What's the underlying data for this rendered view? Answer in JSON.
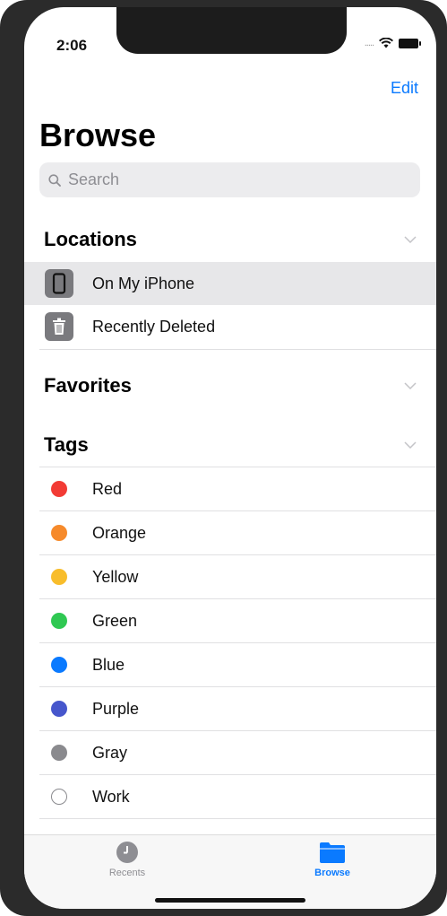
{
  "status": {
    "time": "2:06",
    "signal": "....."
  },
  "nav": {
    "edit_label": "Edit",
    "title": "Browse"
  },
  "search": {
    "placeholder": "Search"
  },
  "locations": {
    "title": "Locations",
    "items": [
      {
        "label": "On My iPhone",
        "icon": "phone-icon",
        "selected": true
      },
      {
        "label": "Recently Deleted",
        "icon": "trash-icon",
        "selected": false
      }
    ]
  },
  "favorites": {
    "title": "Favorites"
  },
  "tags": {
    "title": "Tags",
    "items": [
      {
        "label": "Red",
        "color": "#f23b35"
      },
      {
        "label": "Orange",
        "color": "#f68a2b"
      },
      {
        "label": "Yellow",
        "color": "#f8bd2b"
      },
      {
        "label": "Green",
        "color": "#2fc852"
      },
      {
        "label": "Blue",
        "color": "#0a7aff"
      },
      {
        "label": "Purple",
        "color": "#4656cc"
      },
      {
        "label": "Gray",
        "color": "#8a8a8e"
      },
      {
        "label": "Work",
        "color": "#ffffff"
      }
    ]
  },
  "tab_bar": {
    "tabs": [
      {
        "label": "Recents",
        "icon": "clock-icon",
        "active": false
      },
      {
        "label": "Browse",
        "icon": "folder-icon",
        "active": true
      }
    ],
    "active_color": "#0a7aff",
    "inactive_color": "#8e8e93"
  }
}
